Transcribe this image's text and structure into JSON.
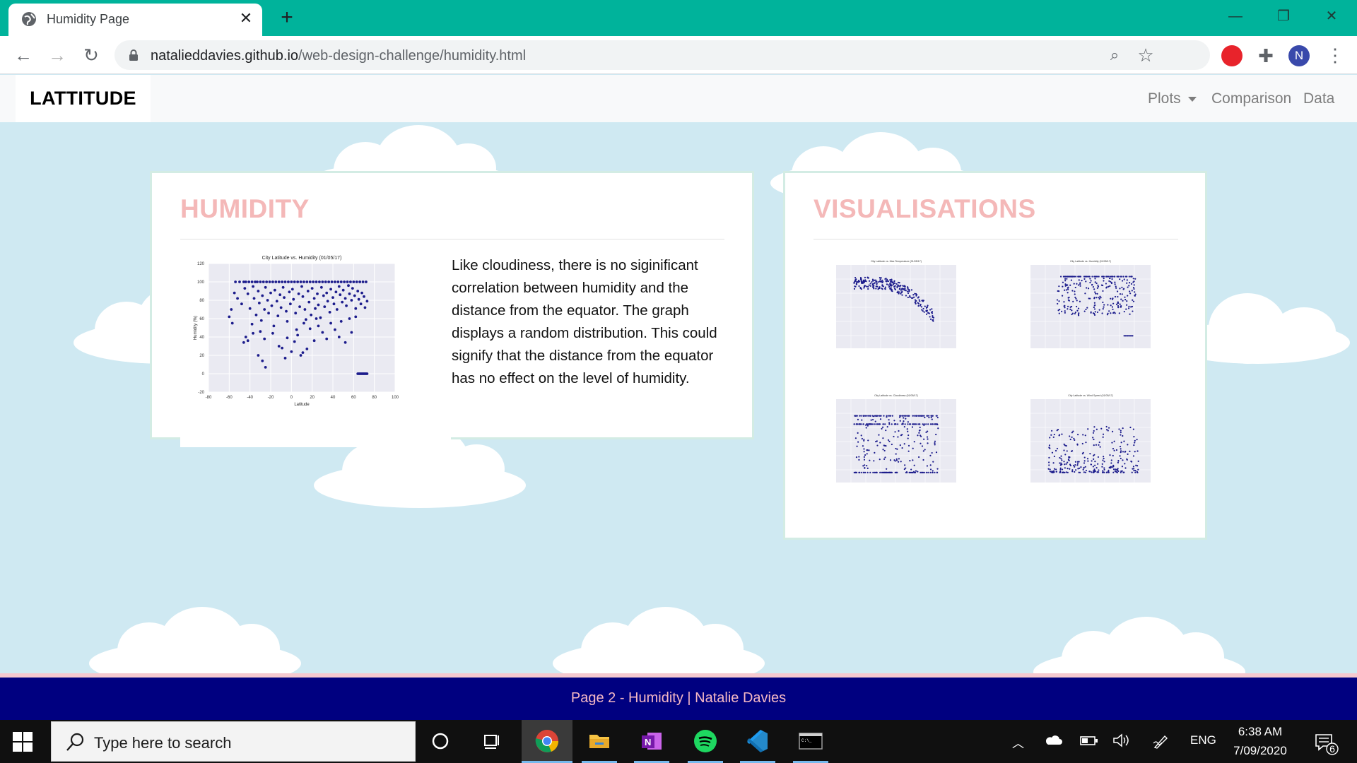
{
  "browser": {
    "tab_title": "Humidity Page",
    "tab_close": "✕",
    "new_tab": "+",
    "url_host": "natalieddavies.github.io",
    "url_path": "/web-design-challenge/humidity.html",
    "avatar_letter": "N",
    "window_controls": {
      "minimize": "—",
      "restore": "❐",
      "close": "✕"
    }
  },
  "site_nav": {
    "brand": "LATTITUDE",
    "links": [
      "Plots",
      "Comparison",
      "Data"
    ]
  },
  "humidity_panel": {
    "title": "HUMIDITY",
    "description": "Like cloudiness, there is no siginificant correlation between humidity and the distance from the equator. The graph displays a random distribution. This could signify that the distance from the equator has no effect on the level of humidity."
  },
  "visual_panel": {
    "title": "VISUALISATIONS",
    "thumbnails": [
      "City Latitude vs. Max Temperature (01/05/17)",
      "City Latitude vs. Humidity (01/05/17)",
      "City Latitude vs. Cloudiness (01/05/17)",
      "City Latitude vs. Wind Speed (01/05/17)"
    ]
  },
  "footer": {
    "text": "Page 2 - Humidity | Natalie Davies"
  },
  "taskbar": {
    "search_placeholder": "Type here to search",
    "language": "ENG",
    "time": "6:38 AM",
    "date": "7/09/2020",
    "notification_count": "6"
  },
  "chart_data": {
    "type": "scatter",
    "title": "City Latitude vs. Humidity (01/05/17)",
    "xlabel": "Latitude",
    "ylabel": "Humidity (%)",
    "xlim": [
      -80,
      100
    ],
    "ylim": [
      -20,
      120
    ],
    "xticks": [
      -80,
      -60,
      -40,
      -20,
      0,
      20,
      40,
      60,
      80,
      100
    ],
    "yticks": [
      -20,
      0,
      20,
      40,
      60,
      80,
      100,
      120
    ],
    "grid": true,
    "marker_color": "#1c1c8c",
    "points": [
      [
        -54,
        100
      ],
      [
        -50,
        100
      ],
      [
        -46,
        100
      ],
      [
        -44,
        100
      ],
      [
        -41,
        100
      ],
      [
        -38,
        100
      ],
      [
        -35,
        100
      ],
      [
        -33,
        100
      ],
      [
        -30,
        100
      ],
      [
        -27,
        100
      ],
      [
        -24,
        100
      ],
      [
        -21,
        100
      ],
      [
        -18,
        100
      ],
      [
        -15,
        100
      ],
      [
        -12,
        100
      ],
      [
        -9,
        100
      ],
      [
        -6,
        100
      ],
      [
        -3,
        100
      ],
      [
        0,
        100
      ],
      [
        3,
        100
      ],
      [
        6,
        100
      ],
      [
        9,
        100
      ],
      [
        12,
        100
      ],
      [
        15,
        100
      ],
      [
        18,
        100
      ],
      [
        21,
        100
      ],
      [
        24,
        100
      ],
      [
        27,
        100
      ],
      [
        30,
        100
      ],
      [
        33,
        100
      ],
      [
        36,
        100
      ],
      [
        39,
        100
      ],
      [
        42,
        100
      ],
      [
        45,
        100
      ],
      [
        48,
        100
      ],
      [
        51,
        100
      ],
      [
        54,
        100
      ],
      [
        57,
        100
      ],
      [
        60,
        100
      ],
      [
        63,
        100
      ],
      [
        66,
        100
      ],
      [
        69,
        100
      ],
      [
        72,
        100
      ],
      [
        -55,
        88
      ],
      [
        -52,
        82
      ],
      [
        -48,
        76
      ],
      [
        -45,
        93
      ],
      [
        -42,
        87
      ],
      [
        -40,
        71
      ],
      [
        -37,
        95
      ],
      [
        -36,
        82
      ],
      [
        -34,
        64
      ],
      [
        -32,
        90
      ],
      [
        -31,
        77
      ],
      [
        -29,
        58
      ],
      [
        -28,
        85
      ],
      [
        -26,
        70
      ],
      [
        -25,
        94
      ],
      [
        -23,
        80
      ],
      [
        -22,
        66
      ],
      [
        -20,
        88
      ],
      [
        -19,
        74
      ],
      [
        -17,
        52
      ],
      [
        -16,
        91
      ],
      [
        -14,
        79
      ],
      [
        -13,
        63
      ],
      [
        -11,
        86
      ],
      [
        -10,
        72
      ],
      [
        -8,
        94
      ],
      [
        -7,
        83
      ],
      [
        -5,
        68
      ],
      [
        -4,
        57
      ],
      [
        -2,
        89
      ],
      [
        -1,
        76
      ],
      [
        1,
        92
      ],
      [
        2,
        81
      ],
      [
        4,
        66
      ],
      [
        5,
        48
      ],
      [
        7,
        87
      ],
      [
        8,
        73
      ],
      [
        10,
        95
      ],
      [
        11,
        84
      ],
      [
        13,
        70
      ],
      [
        14,
        59
      ],
      [
        16,
        90
      ],
      [
        17,
        78
      ],
      [
        19,
        64
      ],
      [
        20,
        93
      ],
      [
        22,
        82
      ],
      [
        23,
        71
      ],
      [
        25,
        87
      ],
      [
        26,
        75
      ],
      [
        28,
        61
      ],
      [
        29,
        94
      ],
      [
        31,
        85
      ],
      [
        32,
        73
      ],
      [
        34,
        88
      ],
      [
        35,
        79
      ],
      [
        37,
        67
      ],
      [
        38,
        92
      ],
      [
        40,
        83
      ],
      [
        41,
        76
      ],
      [
        43,
        89
      ],
      [
        44,
        70
      ],
      [
        46,
        95
      ],
      [
        47,
        86
      ],
      [
        49,
        78
      ],
      [
        50,
        91
      ],
      [
        52,
        82
      ],
      [
        53,
        74
      ],
      [
        55,
        96
      ],
      [
        56,
        87
      ],
      [
        58,
        80
      ],
      [
        59,
        93
      ],
      [
        61,
        85
      ],
      [
        62,
        71
      ],
      [
        64,
        90
      ],
      [
        65,
        81
      ],
      [
        67,
        76
      ],
      [
        68,
        88
      ],
      [
        70,
        84
      ],
      [
        71,
        72
      ],
      [
        73,
        79
      ],
      [
        -58,
        70
      ],
      [
        -60,
        62
      ],
      [
        -57,
        55
      ],
      [
        -44,
        40
      ],
      [
        -42,
        36
      ],
      [
        -46,
        34
      ],
      [
        -38,
        54
      ],
      [
        -30,
        46
      ],
      [
        -26,
        38
      ],
      [
        -18,
        44
      ],
      [
        -12,
        30
      ],
      [
        -9,
        28
      ],
      [
        -4,
        39
      ],
      [
        0,
        24
      ],
      [
        3,
        35
      ],
      [
        6,
        42
      ],
      [
        9,
        20
      ],
      [
        11,
        23
      ],
      [
        15,
        27
      ],
      [
        18,
        49
      ],
      [
        22,
        36
      ],
      [
        26,
        52
      ],
      [
        30,
        45
      ],
      [
        34,
        38
      ],
      [
        38,
        55
      ],
      [
        42,
        48
      ],
      [
        46,
        40
      ],
      [
        52,
        34
      ],
      [
        -32,
        20
      ],
      [
        -28,
        14
      ],
      [
        -25,
        7
      ],
      [
        -6,
        17
      ],
      [
        -37,
        44
      ],
      [
        12,
        55
      ],
      [
        24,
        60
      ],
      [
        48,
        57
      ],
      [
        56,
        60
      ],
      [
        62,
        62
      ],
      [
        58,
        45
      ],
      [
        64,
        0
      ],
      [
        65,
        0
      ],
      [
        66,
        0
      ],
      [
        67,
        0
      ],
      [
        68,
        0
      ],
      [
        69,
        0
      ],
      [
        70,
        0
      ],
      [
        71,
        0
      ],
      [
        72,
        0
      ],
      [
        73,
        0
      ]
    ]
  }
}
